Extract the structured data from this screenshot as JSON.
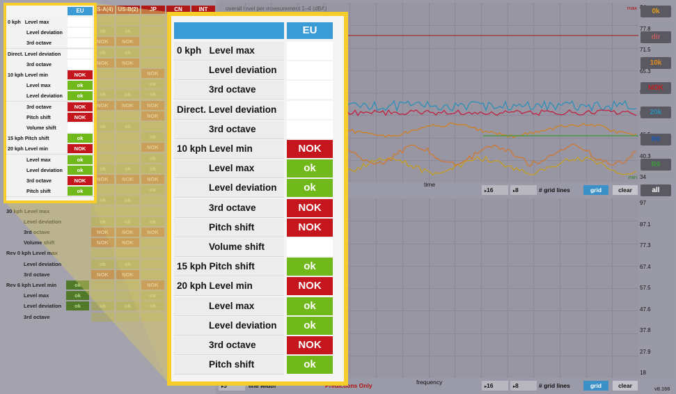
{
  "bg_matrix": {
    "headers": [
      "EU",
      "US-A(4)",
      "US-B(2)",
      "JP",
      "CN",
      "INT"
    ],
    "rows": [
      {
        "label": "0 kph   Level max",
        "indent": false,
        "cells": [
          "",
          "",
          "",
          "",
          "",
          ""
        ]
      },
      {
        "label": "Level deviation",
        "indent": true,
        "cells": [
          "",
          "ok",
          "ok",
          "",
          "",
          ""
        ]
      },
      {
        "label": "3rd octave",
        "indent": true,
        "cells": [
          "",
          "NOK",
          "NOK",
          "",
          "",
          ""
        ]
      },
      {
        "label": "Direct. Level deviation",
        "indent": false,
        "cells": [
          "",
          "ok",
          "ok",
          "",
          "",
          ""
        ]
      },
      {
        "label": "3rd octave",
        "indent": true,
        "cells": [
          "",
          "NOK",
          "NOK",
          "",
          "",
          ""
        ]
      },
      {
        "label": "10 kph Level min",
        "indent": false,
        "cells": [
          "NOK",
          "",
          "",
          "NOK",
          "",
          ""
        ]
      },
      {
        "label": "Level max",
        "indent": true,
        "cells": [
          "ok",
          "",
          "",
          "ok",
          "",
          ""
        ]
      },
      {
        "label": "Level deviation",
        "indent": true,
        "cells": [
          "ok",
          "ok",
          "ok",
          "ok",
          "",
          ""
        ]
      },
      {
        "label": "3rd octave",
        "indent": true,
        "cells": [
          "NOK",
          "NOK",
          "NOK",
          "NOK",
          "",
          ""
        ]
      },
      {
        "label": "Pitch shift",
        "indent": true,
        "cells": [
          "NOK",
          "",
          "",
          "NOK",
          "",
          ""
        ]
      },
      {
        "label": "Volume shift",
        "indent": true,
        "cells": [
          "",
          "ok",
          "ok",
          "",
          "",
          ""
        ]
      },
      {
        "label": "15 kph Pitch shift",
        "indent": false,
        "cells": [
          "ok",
          "",
          "",
          "ok",
          "",
          ""
        ]
      },
      {
        "label": "20 kph Level min",
        "indent": false,
        "cells": [
          "NOK",
          "",
          "",
          "NOK",
          "",
          ""
        ]
      },
      {
        "label": "Level max",
        "indent": true,
        "cells": [
          "ok",
          "",
          "",
          "ok",
          "",
          ""
        ]
      },
      {
        "label": "Level deviation",
        "indent": true,
        "cells": [
          "ok",
          "ok",
          "ok",
          "ok",
          "",
          ""
        ]
      },
      {
        "label": "3rd octave",
        "indent": true,
        "cells": [
          "NOK",
          "NOK",
          "NOK",
          "NOK",
          "",
          ""
        ]
      },
      {
        "label": "Pitch shift",
        "indent": true,
        "cells": [
          "ok",
          "",
          "",
          "ok",
          "",
          ""
        ]
      },
      {
        "label": "Volume shift",
        "indent": true,
        "cells": [
          "",
          "ok",
          "ok",
          "",
          "",
          ""
        ]
      },
      {
        "label": "30 kph Level max",
        "indent": false,
        "cells": [
          "",
          "",
          "",
          "",
          "",
          ""
        ]
      },
      {
        "label": "Level deviation",
        "indent": true,
        "cells": [
          "",
          "ok",
          "ok",
          "ok",
          "",
          ""
        ]
      },
      {
        "label": "3rd octave",
        "indent": true,
        "cells": [
          "",
          "NOK",
          "NOK",
          "NOK",
          "",
          ""
        ]
      },
      {
        "label": "Volume shift",
        "indent": true,
        "cells": [
          "",
          "NOK",
          "NOK",
          "",
          "",
          ""
        ]
      },
      {
        "label": "Rev 0 kph Level max",
        "indent": false,
        "cells": [
          "",
          "",
          "",
          "",
          "",
          ""
        ]
      },
      {
        "label": "Level deviation",
        "indent": true,
        "cells": [
          "",
          "ok",
          "ok",
          "",
          "",
          ""
        ]
      },
      {
        "label": "3rd octave",
        "indent": true,
        "cells": [
          "",
          "NOK",
          "NOK",
          "",
          "",
          ""
        ]
      },
      {
        "label": "Rev 6 kph Level min",
        "indent": false,
        "cells": [
          "ok",
          "",
          "",
          "NOK",
          "",
          ""
        ]
      },
      {
        "label": "Level max",
        "indent": true,
        "cells": [
          "ok",
          "",
          "",
          "ok",
          "",
          ""
        ]
      },
      {
        "label": "Level deviation",
        "indent": true,
        "cells": [
          "ok",
          "ok",
          "ok",
          "ok",
          "",
          ""
        ]
      },
      {
        "label": "3rd octave",
        "indent": true,
        "cells": [
          "",
          "",
          "",
          "",
          "",
          ""
        ]
      }
    ]
  },
  "small_table": {
    "header": "EU",
    "rows": [
      {
        "label": "0 kph   Level max",
        "indent": false,
        "value": ""
      },
      {
        "label": "Level deviation",
        "indent": true,
        "value": ""
      },
      {
        "label": "3rd octave",
        "indent": true,
        "value": ""
      },
      {
        "label": "Direct. Level deviation",
        "indent": false,
        "value": ""
      },
      {
        "label": "3rd octave",
        "indent": true,
        "value": ""
      },
      {
        "label": "10 kph Level min",
        "indent": false,
        "value": "NOK"
      },
      {
        "label": "Level max",
        "indent": true,
        "value": "ok"
      },
      {
        "label": "Level deviation",
        "indent": true,
        "value": "ok"
      },
      {
        "label": "3rd octave",
        "indent": true,
        "value": "NOK"
      },
      {
        "label": "Pitch shift",
        "indent": true,
        "value": "NOK"
      },
      {
        "label": "Volume shift",
        "indent": true,
        "value": ""
      },
      {
        "label": "15 kph Pitch shift",
        "indent": false,
        "value": "ok"
      },
      {
        "label": "20 kph Level min",
        "indent": false,
        "value": "NOK"
      },
      {
        "label": "Level max",
        "indent": true,
        "value": "ok"
      },
      {
        "label": "Level deviation",
        "indent": true,
        "value": "ok"
      },
      {
        "label": "3rd octave",
        "indent": true,
        "value": "NOK"
      },
      {
        "label": "Pitch shift",
        "indent": true,
        "value": "ok"
      }
    ]
  },
  "big_table": {
    "header": "EU",
    "rows": [
      {
        "label": "0 kph   Level max",
        "indent": false,
        "value": ""
      },
      {
        "label": "Level deviation",
        "indent": true,
        "value": ""
      },
      {
        "label": "3rd octave",
        "indent": true,
        "value": ""
      },
      {
        "label": "Direct. Level deviation",
        "indent": false,
        "value": ""
      },
      {
        "label": "3rd octave",
        "indent": true,
        "value": ""
      },
      {
        "label": "10 kph Level min",
        "indent": false,
        "value": "NOK"
      },
      {
        "label": "Level max",
        "indent": true,
        "value": "ok"
      },
      {
        "label": "Level deviation",
        "indent": true,
        "value": "ok"
      },
      {
        "label": "3rd octave",
        "indent": true,
        "value": "NOK"
      },
      {
        "label": "Pitch shift",
        "indent": true,
        "value": "NOK"
      },
      {
        "label": "Volume shift",
        "indent": true,
        "value": ""
      },
      {
        "label": "15 kph Pitch shift",
        "indent": false,
        "value": "ok"
      },
      {
        "label": "20 kph Level min",
        "indent": false,
        "value": "NOK"
      },
      {
        "label": "Level max",
        "indent": true,
        "value": "ok"
      },
      {
        "label": "Level deviation",
        "indent": true,
        "value": "ok"
      },
      {
        "label": "3rd octave",
        "indent": true,
        "value": "NOK"
      },
      {
        "label": "Pitch shift",
        "indent": true,
        "value": "ok"
      }
    ]
  },
  "top_graph": {
    "title": "overall level per measurement 1–4 (dBA)",
    "x_label": "time",
    "max_label": "max",
    "min_label": "min",
    "y_ticks": [
      "84",
      "77.8",
      "71.5",
      "65.3",
      "59.",
      "52.8",
      "46.5",
      "40.3",
      "34"
    ],
    "controls": {
      "x_grid": "16",
      "y_grid": "8",
      "grid_label": "# grid lines",
      "grid_btn": "grid",
      "clear_btn": "clear"
    }
  },
  "bottom_graph": {
    "x_label": "frequency",
    "y_ticks": [
      "97",
      "87.1",
      "77.3",
      "67.4",
      "57.5",
      "47.6",
      "37.8",
      "27.9",
      "18"
    ],
    "controls": {
      "line_width_value": "5",
      "line_width_label": "line width",
      "status": "Predictions Only",
      "x_grid": "16",
      "y_grid": "8",
      "grid_label": "# grid lines",
      "grid_btn": "grid",
      "clear_btn": "clear"
    },
    "version": "v8.166"
  },
  "side_buttons": [
    {
      "label": "0k",
      "color": "#e0a020"
    },
    {
      "label": "dir",
      "color": "#c06060"
    },
    {
      "label": "10k",
      "color": "#e08a20"
    },
    {
      "label": "NOK",
      "color": "#c02020"
    },
    {
      "label": "20k",
      "color": "#2c8fb8"
    },
    {
      "label": "R0",
      "color": "#1a5ab8"
    },
    {
      "label": "R6",
      "color": "#3a9a3a"
    },
    {
      "label": "all",
      "color": "#ffffff"
    }
  ],
  "colors": {
    "ok": "#71b81b",
    "nok": "#c4161c",
    "header": "#3b9bd4",
    "frame": "#f7cd2c"
  }
}
